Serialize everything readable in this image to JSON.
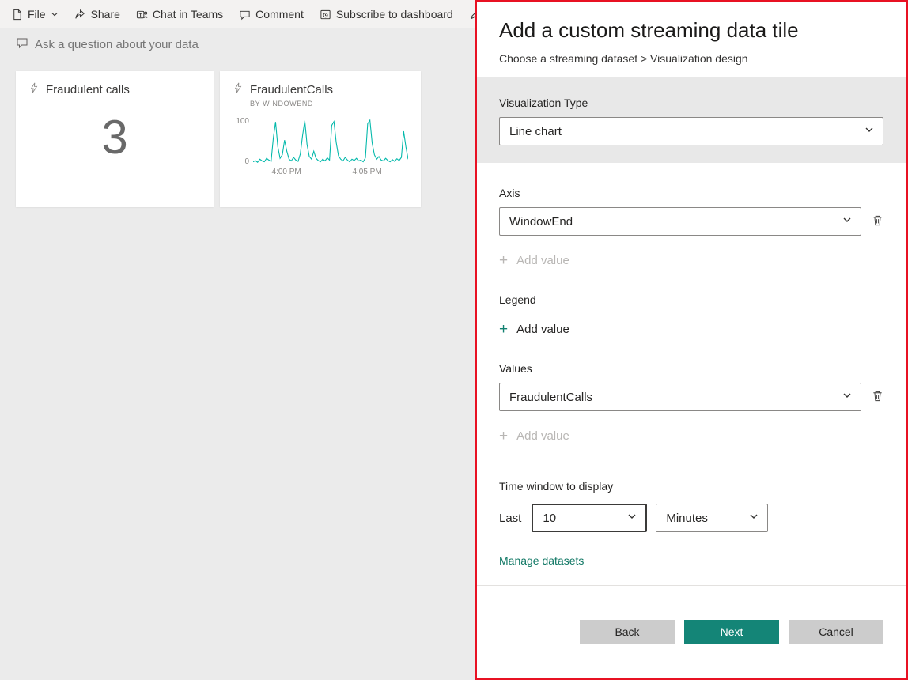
{
  "toolbar": {
    "file": "File",
    "share": "Share",
    "chat": "Chat in Teams",
    "comment": "Comment",
    "subscribe": "Subscribe to dashboard"
  },
  "icons": {
    "plus": "+"
  },
  "qna": {
    "placeholder": "Ask a question about your data"
  },
  "tiles": {
    "card": {
      "title": "Fraudulent calls",
      "value": "3"
    },
    "chart": {
      "title": "FraudulentCalls",
      "subtitle": "BY WINDOWEND"
    }
  },
  "chart_data": {
    "type": "line",
    "title": "FraudulentCalls",
    "subtitle": "BY WINDOWEND",
    "series_color": "#01b8aa",
    "ylim": [
      0,
      100
    ],
    "y_ticks": [
      "100",
      "0"
    ],
    "x_ticks": [
      "4:00 PM",
      "4:05 PM"
    ],
    "xlabel": "WindowEnd",
    "ylabel": "FraudulentCalls",
    "grid": false,
    "legend": false,
    "values": [
      6,
      9,
      5,
      12,
      8,
      6,
      14,
      10,
      7,
      60,
      96,
      40,
      14,
      22,
      55,
      30,
      12,
      8,
      16,
      10,
      7,
      24,
      65,
      99,
      45,
      18,
      12,
      30,
      14,
      9,
      6,
      12,
      8,
      15,
      10,
      88,
      97,
      50,
      20,
      12,
      8,
      16,
      10,
      6,
      12,
      9,
      14,
      8,
      10,
      6,
      15,
      92,
      100,
      48,
      22,
      12,
      18,
      10,
      8,
      14,
      9,
      6,
      11,
      7,
      13,
      9,
      16,
      75,
      40,
      12
    ]
  },
  "panel": {
    "title": "Add a custom streaming data tile",
    "breadcrumb": "Choose a streaming dataset > Visualization design",
    "sections": {
      "visualization_type": {
        "label": "Visualization Type",
        "value": "Line chart"
      },
      "axis": {
        "label": "Axis",
        "value": "WindowEnd",
        "add_value": "Add value"
      },
      "legend": {
        "label": "Legend",
        "add_value": "Add value"
      },
      "values": {
        "label": "Values",
        "value": "FraudulentCalls",
        "add_value": "Add value"
      },
      "time_window": {
        "label": "Time window to display",
        "prefix": "Last",
        "amount": "10",
        "unit": "Minutes"
      }
    },
    "manage_datasets": "Manage datasets",
    "buttons": {
      "back": "Back",
      "next": "Next",
      "cancel": "Cancel"
    }
  },
  "colors": {
    "chart_line": "#01b8aa",
    "next_button": "#148577",
    "highlight_border": "#e81123",
    "link": "#117865"
  }
}
